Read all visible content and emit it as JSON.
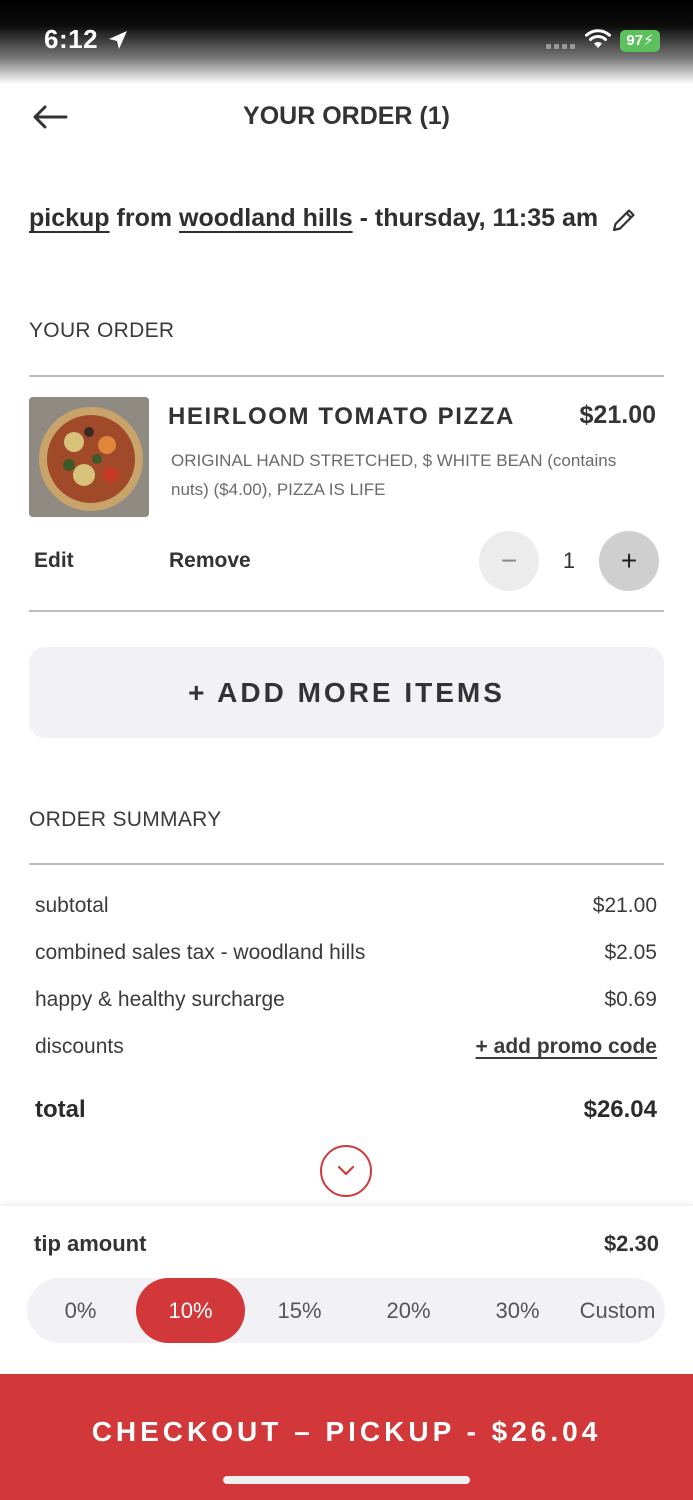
{
  "status_bar": {
    "time": "6:12",
    "battery": "97"
  },
  "header": {
    "title": "YOUR ORDER (1)"
  },
  "pickup": {
    "mode": "pickup",
    "from": "from",
    "location": "woodland hills",
    "when": "- thursday, 11:35 am"
  },
  "order_section": {
    "label": "YOUR ORDER"
  },
  "item": {
    "name": "HEIRLOOM TOMATO PIZZA",
    "price": "$21.00",
    "description": "ORIGINAL HAND STRETCHED, $ WHITE BEAN (contains nuts) ($4.00), PIZZA IS LIFE",
    "edit_label": "Edit",
    "remove_label": "Remove",
    "quantity": "1",
    "minus": "−",
    "plus": "+"
  },
  "add_more": {
    "label": "+ ADD MORE ITEMS"
  },
  "summary": {
    "label": "ORDER SUMMARY",
    "rows": [
      {
        "label": "subtotal",
        "value": "$21.00"
      },
      {
        "label": "combined sales tax - woodland hills",
        "value": "$2.05"
      },
      {
        "label": "happy & healthy surcharge",
        "value": "$0.69"
      },
      {
        "label": "discounts",
        "value": "+ add promo code"
      }
    ],
    "total_label": "total",
    "total_value": "$26.04"
  },
  "tip": {
    "label": "tip amount",
    "amount": "$2.30",
    "options": [
      "0%",
      "10%",
      "15%",
      "20%",
      "30%",
      "Custom"
    ],
    "selected": "10%"
  },
  "checkout": {
    "label": "CHECKOUT – PICKUP - $26.04"
  },
  "colors": {
    "accent": "#d2383a",
    "panel": "#f2f2f6",
    "battery": "#5cc15c"
  }
}
